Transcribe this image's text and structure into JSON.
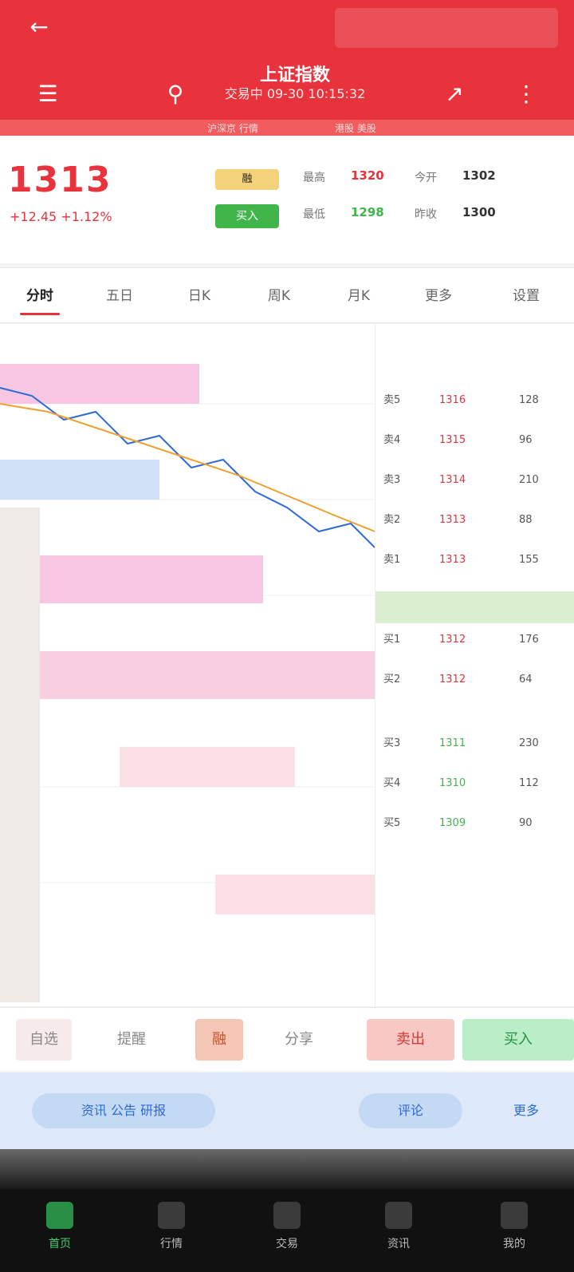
{
  "header": {
    "back_icon": "back-arrow-icon",
    "title": "上证指数",
    "subtitle": "交易中 09-30 10:15:32",
    "status_strip_left": "沪深京 行情",
    "status_strip_right": "港股 美股",
    "icons": [
      "menu-icon",
      "search-icon",
      "share-icon",
      "more-icon"
    ]
  },
  "quote": {
    "price": "1313",
    "change": "+12.45 +1.12%",
    "badge_label": "融",
    "badge2_label": "买入",
    "stats": [
      {
        "label": "最高",
        "value": "1320"
      },
      {
        "label": "最低",
        "value": "1298"
      },
      {
        "label": "今开",
        "value": "1302"
      },
      {
        "label": "昨收",
        "value": "1300"
      }
    ]
  },
  "tabs": [
    "分时",
    "五日",
    "日K",
    "周K",
    "月K",
    "更多",
    "设置"
  ],
  "active_tab_index": 0,
  "chart_note": "分时走势",
  "orderbook": {
    "asks": [
      {
        "label": "卖5",
        "price": "1316",
        "vol": "128"
      },
      {
        "label": "卖4",
        "price": "1315",
        "vol": "96"
      },
      {
        "label": "卖3",
        "price": "1314",
        "vol": "210"
      },
      {
        "label": "卖2",
        "price": "1313",
        "vol": "88"
      },
      {
        "label": "卖1",
        "price": "1313",
        "vol": "155"
      }
    ],
    "bids": [
      {
        "label": "买1",
        "price": "1312",
        "vol": "176"
      },
      {
        "label": "买2",
        "price": "1312",
        "vol": "64"
      },
      {
        "label": "买3",
        "price": "1311",
        "vol": "230"
      },
      {
        "label": "买4",
        "price": "1310",
        "vol": "112"
      },
      {
        "label": "买5",
        "price": "1309",
        "vol": "90"
      }
    ]
  },
  "actions": {
    "a1": "自选",
    "a2": "提醒",
    "a3": "融",
    "a4": "分享",
    "sell": "卖出",
    "buy": "买入"
  },
  "infobar": {
    "left": "资讯 公告 研报",
    "right": "评论",
    "extra": "更多"
  },
  "nav": [
    "首页",
    "行情",
    "交易",
    "资讯",
    "我的"
  ],
  "nav_active": 0,
  "colors": {
    "brand": "#e8323c",
    "up": "#e8323c",
    "down": "#3fb54a",
    "link": "#2d6bd4"
  }
}
